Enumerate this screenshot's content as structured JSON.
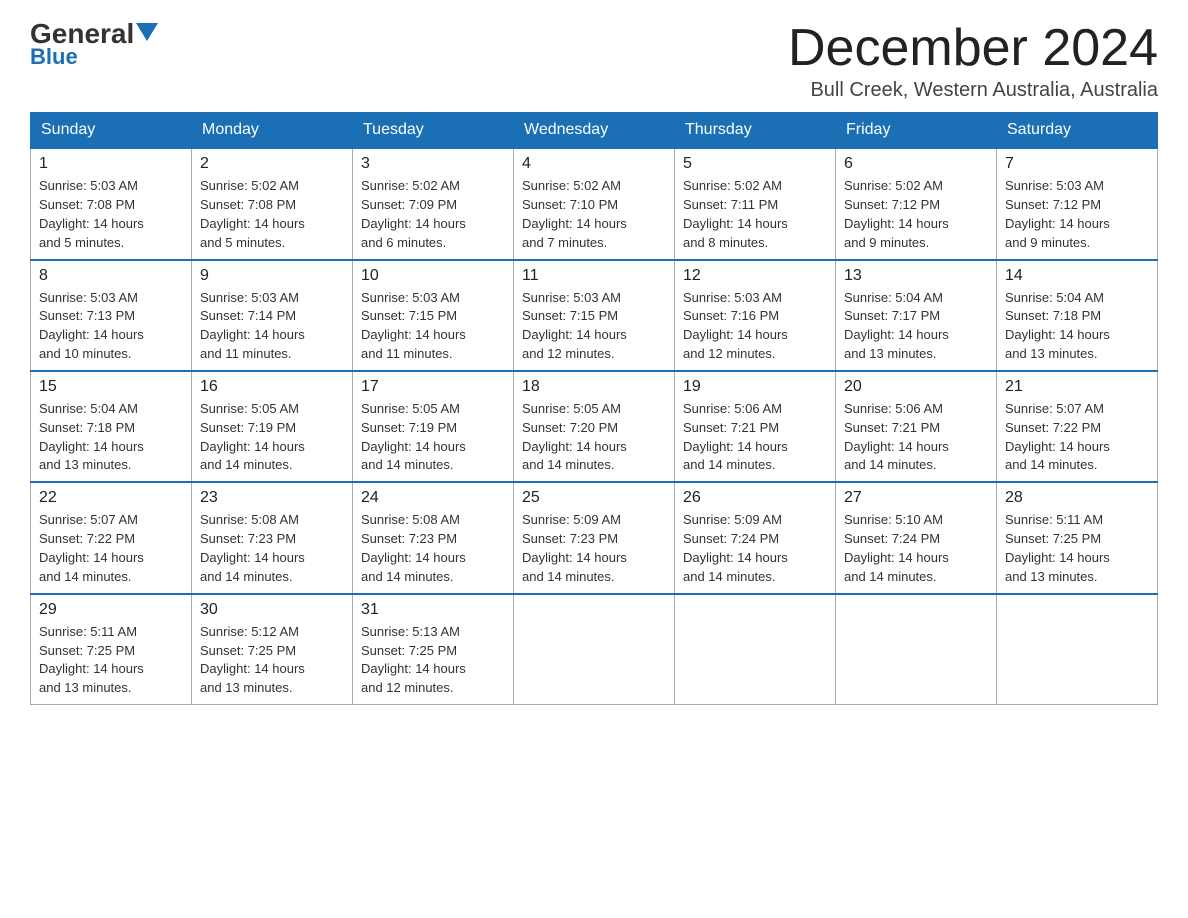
{
  "logo": {
    "general": "General",
    "blue": "Blue",
    "triangle_color": "#1a6fb5"
  },
  "title": {
    "month": "December 2024",
    "location": "Bull Creek, Western Australia, Australia"
  },
  "weekdays": [
    "Sunday",
    "Monday",
    "Tuesday",
    "Wednesday",
    "Thursday",
    "Friday",
    "Saturday"
  ],
  "weeks": [
    [
      {
        "day": "1",
        "sunrise": "5:03 AM",
        "sunset": "7:08 PM",
        "daylight": "14 hours and 5 minutes."
      },
      {
        "day": "2",
        "sunrise": "5:02 AM",
        "sunset": "7:08 PM",
        "daylight": "14 hours and 5 minutes."
      },
      {
        "day": "3",
        "sunrise": "5:02 AM",
        "sunset": "7:09 PM",
        "daylight": "14 hours and 6 minutes."
      },
      {
        "day": "4",
        "sunrise": "5:02 AM",
        "sunset": "7:10 PM",
        "daylight": "14 hours and 7 minutes."
      },
      {
        "day": "5",
        "sunrise": "5:02 AM",
        "sunset": "7:11 PM",
        "daylight": "14 hours and 8 minutes."
      },
      {
        "day": "6",
        "sunrise": "5:02 AM",
        "sunset": "7:12 PM",
        "daylight": "14 hours and 9 minutes."
      },
      {
        "day": "7",
        "sunrise": "5:03 AM",
        "sunset": "7:12 PM",
        "daylight": "14 hours and 9 minutes."
      }
    ],
    [
      {
        "day": "8",
        "sunrise": "5:03 AM",
        "sunset": "7:13 PM",
        "daylight": "14 hours and 10 minutes."
      },
      {
        "day": "9",
        "sunrise": "5:03 AM",
        "sunset": "7:14 PM",
        "daylight": "14 hours and 11 minutes."
      },
      {
        "day": "10",
        "sunrise": "5:03 AM",
        "sunset": "7:15 PM",
        "daylight": "14 hours and 11 minutes."
      },
      {
        "day": "11",
        "sunrise": "5:03 AM",
        "sunset": "7:15 PM",
        "daylight": "14 hours and 12 minutes."
      },
      {
        "day": "12",
        "sunrise": "5:03 AM",
        "sunset": "7:16 PM",
        "daylight": "14 hours and 12 minutes."
      },
      {
        "day": "13",
        "sunrise": "5:04 AM",
        "sunset": "7:17 PM",
        "daylight": "14 hours and 13 minutes."
      },
      {
        "day": "14",
        "sunrise": "5:04 AM",
        "sunset": "7:18 PM",
        "daylight": "14 hours and 13 minutes."
      }
    ],
    [
      {
        "day": "15",
        "sunrise": "5:04 AM",
        "sunset": "7:18 PM",
        "daylight": "14 hours and 13 minutes."
      },
      {
        "day": "16",
        "sunrise": "5:05 AM",
        "sunset": "7:19 PM",
        "daylight": "14 hours and 14 minutes."
      },
      {
        "day": "17",
        "sunrise": "5:05 AM",
        "sunset": "7:19 PM",
        "daylight": "14 hours and 14 minutes."
      },
      {
        "day": "18",
        "sunrise": "5:05 AM",
        "sunset": "7:20 PM",
        "daylight": "14 hours and 14 minutes."
      },
      {
        "day": "19",
        "sunrise": "5:06 AM",
        "sunset": "7:21 PM",
        "daylight": "14 hours and 14 minutes."
      },
      {
        "day": "20",
        "sunrise": "5:06 AM",
        "sunset": "7:21 PM",
        "daylight": "14 hours and 14 minutes."
      },
      {
        "day": "21",
        "sunrise": "5:07 AM",
        "sunset": "7:22 PM",
        "daylight": "14 hours and 14 minutes."
      }
    ],
    [
      {
        "day": "22",
        "sunrise": "5:07 AM",
        "sunset": "7:22 PM",
        "daylight": "14 hours and 14 minutes."
      },
      {
        "day": "23",
        "sunrise": "5:08 AM",
        "sunset": "7:23 PM",
        "daylight": "14 hours and 14 minutes."
      },
      {
        "day": "24",
        "sunrise": "5:08 AM",
        "sunset": "7:23 PM",
        "daylight": "14 hours and 14 minutes."
      },
      {
        "day": "25",
        "sunrise": "5:09 AM",
        "sunset": "7:23 PM",
        "daylight": "14 hours and 14 minutes."
      },
      {
        "day": "26",
        "sunrise": "5:09 AM",
        "sunset": "7:24 PM",
        "daylight": "14 hours and 14 minutes."
      },
      {
        "day": "27",
        "sunrise": "5:10 AM",
        "sunset": "7:24 PM",
        "daylight": "14 hours and 14 minutes."
      },
      {
        "day": "28",
        "sunrise": "5:11 AM",
        "sunset": "7:25 PM",
        "daylight": "14 hours and 13 minutes."
      }
    ],
    [
      {
        "day": "29",
        "sunrise": "5:11 AM",
        "sunset": "7:25 PM",
        "daylight": "14 hours and 13 minutes."
      },
      {
        "day": "30",
        "sunrise": "5:12 AM",
        "sunset": "7:25 PM",
        "daylight": "14 hours and 13 minutes."
      },
      {
        "day": "31",
        "sunrise": "5:13 AM",
        "sunset": "7:25 PM",
        "daylight": "14 hours and 12 minutes."
      },
      null,
      null,
      null,
      null
    ]
  ],
  "labels": {
    "sunrise": "Sunrise:",
    "sunset": "Sunset:",
    "daylight": "Daylight:"
  }
}
